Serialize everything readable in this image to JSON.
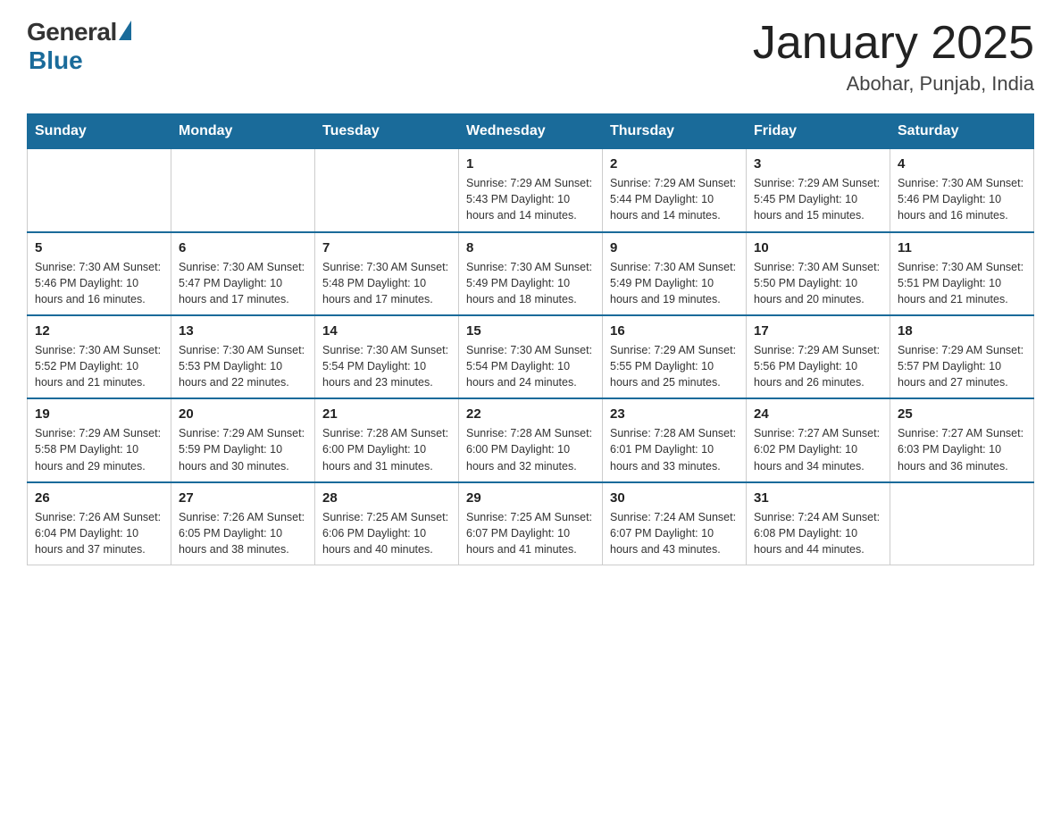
{
  "header": {
    "logo_general": "General",
    "logo_blue": "Blue",
    "month_title": "January 2025",
    "subtitle": "Abohar, Punjab, India"
  },
  "days_of_week": [
    "Sunday",
    "Monday",
    "Tuesday",
    "Wednesday",
    "Thursday",
    "Friday",
    "Saturday"
  ],
  "weeks": [
    [
      {
        "day": "",
        "info": ""
      },
      {
        "day": "",
        "info": ""
      },
      {
        "day": "",
        "info": ""
      },
      {
        "day": "1",
        "info": "Sunrise: 7:29 AM\nSunset: 5:43 PM\nDaylight: 10 hours\nand 14 minutes."
      },
      {
        "day": "2",
        "info": "Sunrise: 7:29 AM\nSunset: 5:44 PM\nDaylight: 10 hours\nand 14 minutes."
      },
      {
        "day": "3",
        "info": "Sunrise: 7:29 AM\nSunset: 5:45 PM\nDaylight: 10 hours\nand 15 minutes."
      },
      {
        "day": "4",
        "info": "Sunrise: 7:30 AM\nSunset: 5:46 PM\nDaylight: 10 hours\nand 16 minutes."
      }
    ],
    [
      {
        "day": "5",
        "info": "Sunrise: 7:30 AM\nSunset: 5:46 PM\nDaylight: 10 hours\nand 16 minutes."
      },
      {
        "day": "6",
        "info": "Sunrise: 7:30 AM\nSunset: 5:47 PM\nDaylight: 10 hours\nand 17 minutes."
      },
      {
        "day": "7",
        "info": "Sunrise: 7:30 AM\nSunset: 5:48 PM\nDaylight: 10 hours\nand 17 minutes."
      },
      {
        "day": "8",
        "info": "Sunrise: 7:30 AM\nSunset: 5:49 PM\nDaylight: 10 hours\nand 18 minutes."
      },
      {
        "day": "9",
        "info": "Sunrise: 7:30 AM\nSunset: 5:49 PM\nDaylight: 10 hours\nand 19 minutes."
      },
      {
        "day": "10",
        "info": "Sunrise: 7:30 AM\nSunset: 5:50 PM\nDaylight: 10 hours\nand 20 minutes."
      },
      {
        "day": "11",
        "info": "Sunrise: 7:30 AM\nSunset: 5:51 PM\nDaylight: 10 hours\nand 21 minutes."
      }
    ],
    [
      {
        "day": "12",
        "info": "Sunrise: 7:30 AM\nSunset: 5:52 PM\nDaylight: 10 hours\nand 21 minutes."
      },
      {
        "day": "13",
        "info": "Sunrise: 7:30 AM\nSunset: 5:53 PM\nDaylight: 10 hours\nand 22 minutes."
      },
      {
        "day": "14",
        "info": "Sunrise: 7:30 AM\nSunset: 5:54 PM\nDaylight: 10 hours\nand 23 minutes."
      },
      {
        "day": "15",
        "info": "Sunrise: 7:30 AM\nSunset: 5:54 PM\nDaylight: 10 hours\nand 24 minutes."
      },
      {
        "day": "16",
        "info": "Sunrise: 7:29 AM\nSunset: 5:55 PM\nDaylight: 10 hours\nand 25 minutes."
      },
      {
        "day": "17",
        "info": "Sunrise: 7:29 AM\nSunset: 5:56 PM\nDaylight: 10 hours\nand 26 minutes."
      },
      {
        "day": "18",
        "info": "Sunrise: 7:29 AM\nSunset: 5:57 PM\nDaylight: 10 hours\nand 27 minutes."
      }
    ],
    [
      {
        "day": "19",
        "info": "Sunrise: 7:29 AM\nSunset: 5:58 PM\nDaylight: 10 hours\nand 29 minutes."
      },
      {
        "day": "20",
        "info": "Sunrise: 7:29 AM\nSunset: 5:59 PM\nDaylight: 10 hours\nand 30 minutes."
      },
      {
        "day": "21",
        "info": "Sunrise: 7:28 AM\nSunset: 6:00 PM\nDaylight: 10 hours\nand 31 minutes."
      },
      {
        "day": "22",
        "info": "Sunrise: 7:28 AM\nSunset: 6:00 PM\nDaylight: 10 hours\nand 32 minutes."
      },
      {
        "day": "23",
        "info": "Sunrise: 7:28 AM\nSunset: 6:01 PM\nDaylight: 10 hours\nand 33 minutes."
      },
      {
        "day": "24",
        "info": "Sunrise: 7:27 AM\nSunset: 6:02 PM\nDaylight: 10 hours\nand 34 minutes."
      },
      {
        "day": "25",
        "info": "Sunrise: 7:27 AM\nSunset: 6:03 PM\nDaylight: 10 hours\nand 36 minutes."
      }
    ],
    [
      {
        "day": "26",
        "info": "Sunrise: 7:26 AM\nSunset: 6:04 PM\nDaylight: 10 hours\nand 37 minutes."
      },
      {
        "day": "27",
        "info": "Sunrise: 7:26 AM\nSunset: 6:05 PM\nDaylight: 10 hours\nand 38 minutes."
      },
      {
        "day": "28",
        "info": "Sunrise: 7:25 AM\nSunset: 6:06 PM\nDaylight: 10 hours\nand 40 minutes."
      },
      {
        "day": "29",
        "info": "Sunrise: 7:25 AM\nSunset: 6:07 PM\nDaylight: 10 hours\nand 41 minutes."
      },
      {
        "day": "30",
        "info": "Sunrise: 7:24 AM\nSunset: 6:07 PM\nDaylight: 10 hours\nand 43 minutes."
      },
      {
        "day": "31",
        "info": "Sunrise: 7:24 AM\nSunset: 6:08 PM\nDaylight: 10 hours\nand 44 minutes."
      },
      {
        "day": "",
        "info": ""
      }
    ]
  ]
}
